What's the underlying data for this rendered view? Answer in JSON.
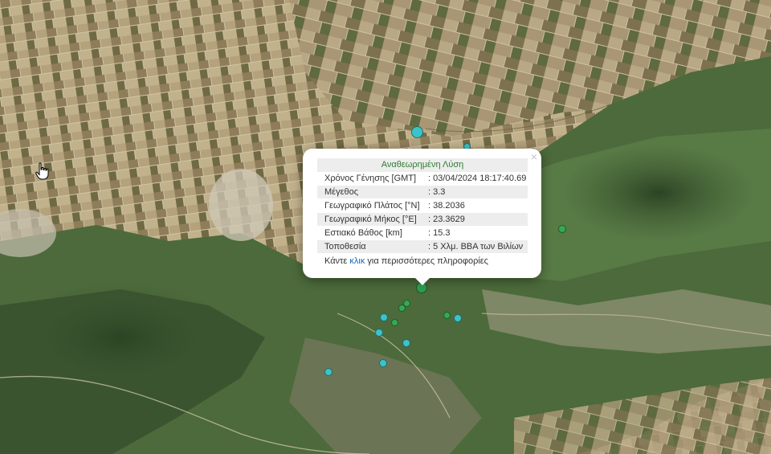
{
  "popup": {
    "title": "Αναθεωρημένη Λύση",
    "close_glyph": "×",
    "rows": [
      {
        "label": "Χρόνος Γένησης [GMT]",
        "value": ": 03/04/2024 18:17:40.69"
      },
      {
        "label": "Μέγεθος",
        "value": ": 3.3"
      },
      {
        "label": "Γεωγραφικό Πλάτος [°N]",
        "value": ": 38.2036"
      },
      {
        "label": "Γεωγραφικό Μήκος [°E]",
        "value": ": 23.3629"
      },
      {
        "label": "Εστιακό Βάθος [km]",
        "value": ": 15.3"
      },
      {
        "label": "Τοποθεσία",
        "value": ": 5 Χλμ. ΒΒΑ των Βιλίων"
      }
    ],
    "more_prefix": "Κάντε ",
    "more_link": "κλικ",
    "more_suffix": " για περισσότερες πληροφορίες"
  },
  "colors": {
    "selected_marker": "#2e9e4f",
    "older_marker": "#3cc3c8",
    "recent_marker": "#35a853",
    "link": "#1565c0",
    "title_text": "#2e7d32"
  },
  "map": {
    "basemap": "satellite",
    "cursor_icon": "hand-pointer-icon"
  }
}
